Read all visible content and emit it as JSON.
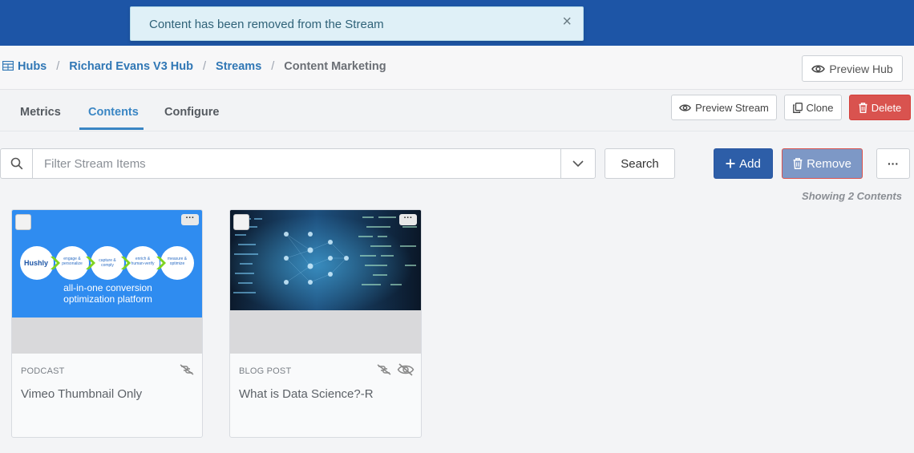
{
  "toast": {
    "message": "Content has been removed from the Stream",
    "close": "×"
  },
  "breadcrumb": {
    "hubs": "Hubs",
    "hub_name": "Richard Evans V3 Hub",
    "streams": "Streams",
    "current": "Content Marketing",
    "separator": "/"
  },
  "header": {
    "preview_hub": "Preview Hub"
  },
  "tabs": [
    {
      "label": "Metrics",
      "active": false
    },
    {
      "label": "Contents",
      "active": true
    },
    {
      "label": "Configure",
      "active": false
    }
  ],
  "stream_actions": {
    "preview_stream": "Preview Stream",
    "clone": "Clone",
    "delete": "Delete"
  },
  "filter": {
    "placeholder": "Filter Stream Items",
    "value": ""
  },
  "toolbar": {
    "search": "Search",
    "add": "Add",
    "remove": "Remove",
    "more": "···"
  },
  "showing": "Showing 2 Contents",
  "cards": [
    {
      "type": "PODCAST",
      "title": "Vimeo Thumbnail Only",
      "thumb": {
        "brand": "Hushly",
        "steps": [
          "engage & personalize",
          "capture & comply",
          "enrich & human-verify",
          "measure & optimize"
        ],
        "tagline_1": "all-in-one conversion",
        "tagline_2": "optimization platform"
      },
      "icons": [
        "link-off-icon"
      ]
    },
    {
      "type": "BLOG POST",
      "title": "What is Data Science?-R",
      "icons": [
        "link-off-icon",
        "eye-slash-icon"
      ]
    }
  ],
  "colors": {
    "topbar": "#1d55a6",
    "link": "#3077b5",
    "active_tab": "#3a86c4",
    "add_button": "#2d5ea8",
    "remove_button": "#7d98c6",
    "delete_button": "#d9534f",
    "hushly_blue": "#2f8cf0"
  }
}
